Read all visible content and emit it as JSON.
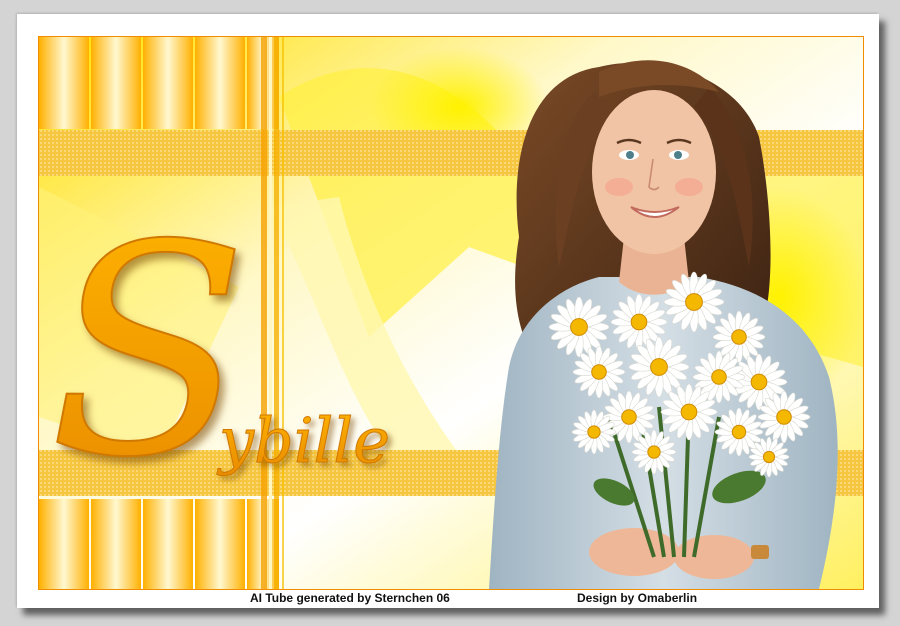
{
  "artwork": {
    "name_text_initial": "S",
    "name_text_rest": "ybille",
    "palette": {
      "accent_orange": "#f5a000",
      "deep_orange": "#e08800",
      "yellow": "#ffe800",
      "pale_yellow": "#fff6a8",
      "border": "#f08c00",
      "sweater": "#b9c9d3",
      "hair": "#6b3f22",
      "skin": "#f0c2a4"
    },
    "subject": "woman-holding-daisy-bouquet"
  },
  "footer": {
    "credit_ai": "AI Tube generated by Sternchen 06",
    "credit_design": "Design by Omaberlin"
  }
}
